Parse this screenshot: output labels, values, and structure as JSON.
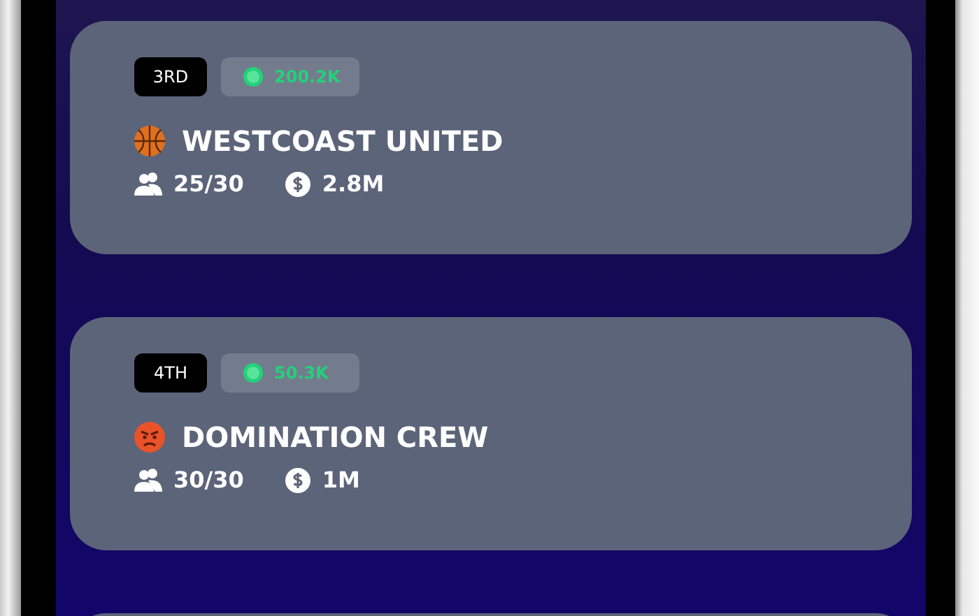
{
  "teams": [
    {
      "rank": "3RD",
      "xp": "200.2K",
      "kind": "basketball",
      "name": "WESTCOAST UNITED",
      "members": "25/30",
      "money": "2.8M"
    },
    {
      "rank": "4TH",
      "xp": "50.3K",
      "kind": "angry-face",
      "name": "DOMINATION CREW",
      "members": "30/30",
      "money": "1M"
    }
  ]
}
